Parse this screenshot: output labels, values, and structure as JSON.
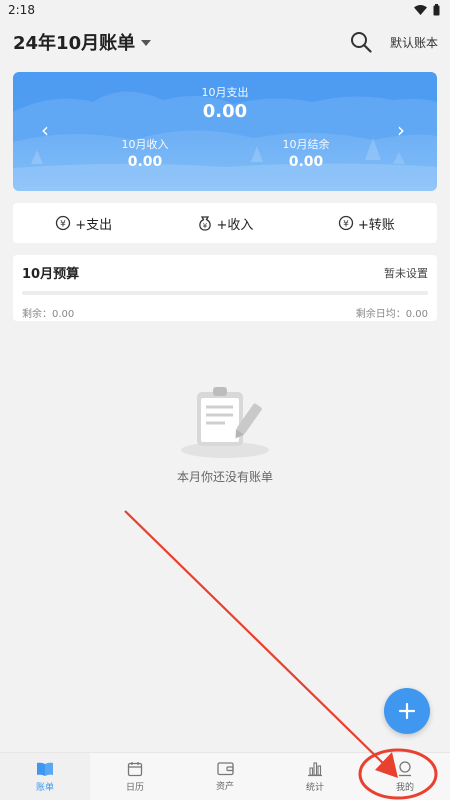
{
  "status": {
    "time": "2:18",
    "icons": [
      "wifi-icon",
      "battery-icon"
    ]
  },
  "header": {
    "title": "24年10月账单",
    "default_book": "默认账本"
  },
  "summary": {
    "expense_label": "10月支出",
    "expense_value": "0.00",
    "income_label": "10月收入",
    "income_value": "0.00",
    "balance_label": "10月结余",
    "balance_value": "0.00"
  },
  "actions": {
    "expense": "+支出",
    "income": "+收入",
    "transfer": "+转账"
  },
  "budget": {
    "title": "10月预算",
    "setting": "暂未设置",
    "remaining": "剩余：0.00",
    "daily": "剩余日均：0.00",
    "progress": 0
  },
  "empty": {
    "text": "本月你还没有账单"
  },
  "tabs": {
    "bills": "账单",
    "calendar": "日历",
    "assets": "资产",
    "stats": "统计",
    "mine": "我的"
  },
  "colors": {
    "accent": "#3f97f0",
    "card_top": "#4d9bf2",
    "annotation": "#e8412f"
  }
}
